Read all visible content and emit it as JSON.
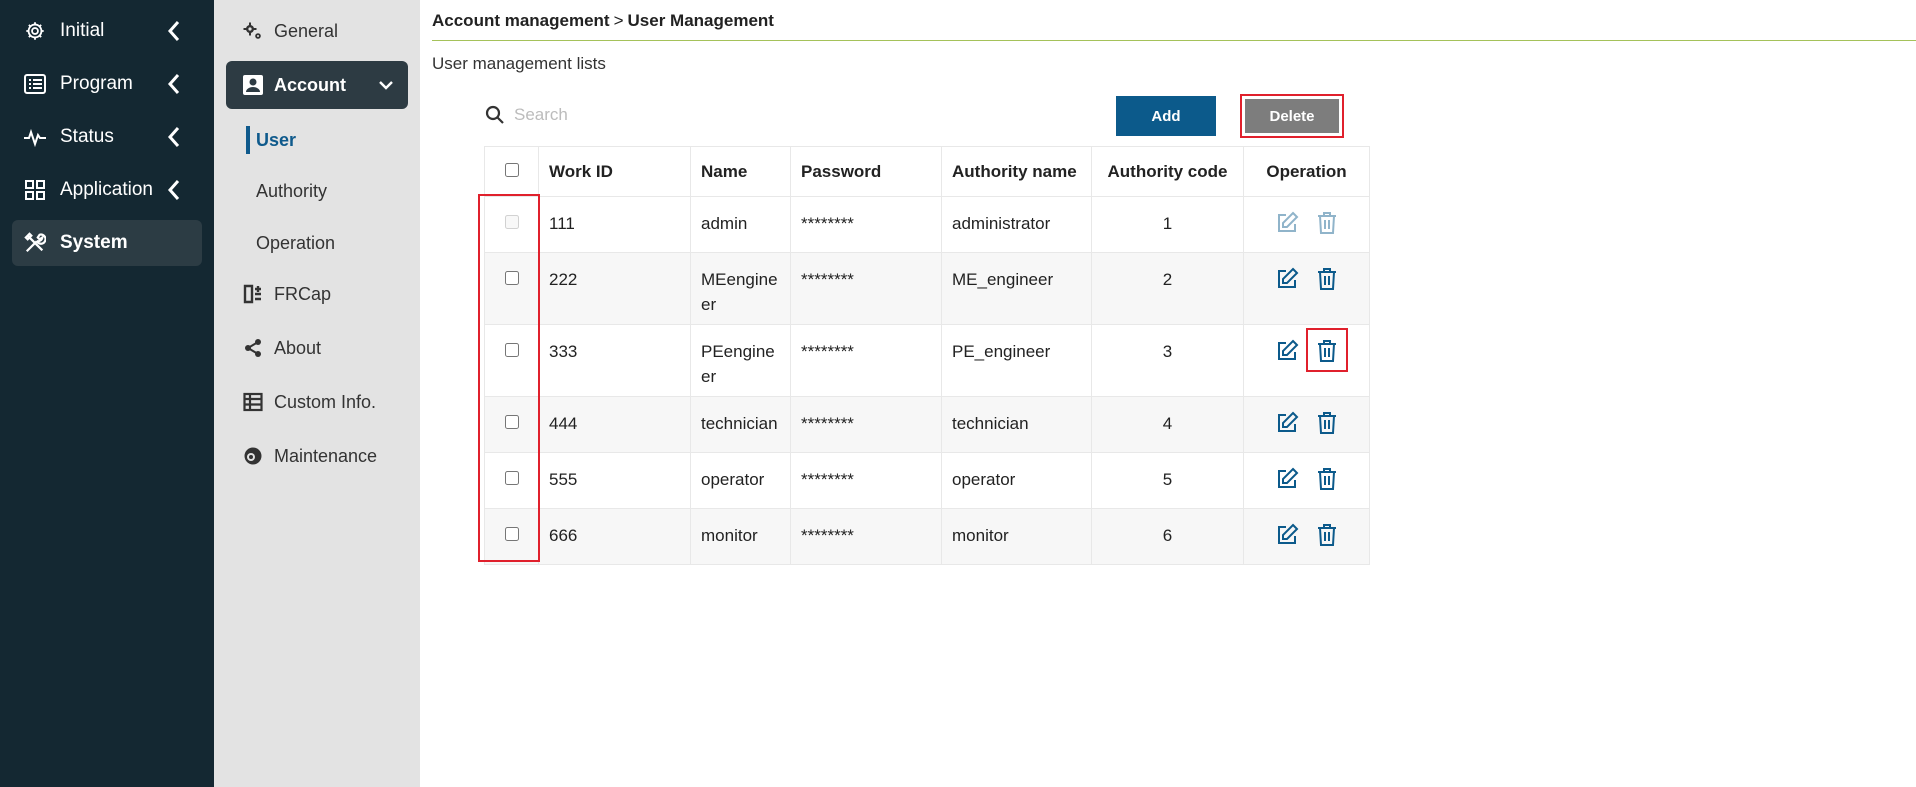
{
  "primary_nav": [
    {
      "label": "Initial",
      "icon": "gear-icon",
      "active": false
    },
    {
      "label": "Program",
      "icon": "list-icon",
      "active": false
    },
    {
      "label": "Status",
      "icon": "pulse-icon",
      "active": false
    },
    {
      "label": "Application",
      "icon": "grid-icon",
      "active": false
    },
    {
      "label": "System",
      "icon": "tools-icon",
      "active": true
    }
  ],
  "secondary_nav": {
    "general": "General",
    "account": "Account",
    "account_sub": [
      "User",
      "Authority",
      "Operation"
    ],
    "frcap": "FRCap",
    "about": "About",
    "custom_info": "Custom Info.",
    "maintenance": "Maintenance"
  },
  "breadcrumb": {
    "parent": "Account management",
    "separator": ">",
    "current": "User Management"
  },
  "subtitle": "User management lists",
  "search": {
    "placeholder": "Search",
    "value": ""
  },
  "buttons": {
    "add": "Add",
    "delete": "Delete"
  },
  "colors": {
    "primary": "#0c5a8b",
    "nav_bg": "#142832",
    "accent_line": "#a5c25a",
    "highlight": "#e0202c",
    "delete_btn": "#7d7d7d"
  },
  "table": {
    "columns": [
      "Work ID",
      "Name",
      "Password",
      "Authority name",
      "Authority code",
      "Operation"
    ],
    "rows": [
      {
        "id": "111",
        "name": "admin",
        "password": "********",
        "authority": "administrator",
        "code": "1",
        "disabled": true
      },
      {
        "id": "222",
        "name": "MEengine\ner",
        "password": "********",
        "authority": "ME_engineer",
        "code": "2",
        "disabled": false
      },
      {
        "id": "333",
        "name": "PEengine\ner",
        "password": "********",
        "authority": "PE_engineer",
        "code": "3",
        "disabled": false
      },
      {
        "id": "444",
        "name": "technician",
        "password": "********",
        "authority": "technician",
        "code": "4",
        "disabled": false
      },
      {
        "id": "555",
        "name": "operator",
        "password": "********",
        "authority": "operator",
        "code": "5",
        "disabled": false
      },
      {
        "id": "666",
        "name": "monitor",
        "password": "********",
        "authority": "monitor",
        "code": "6",
        "disabled": false
      }
    ]
  }
}
